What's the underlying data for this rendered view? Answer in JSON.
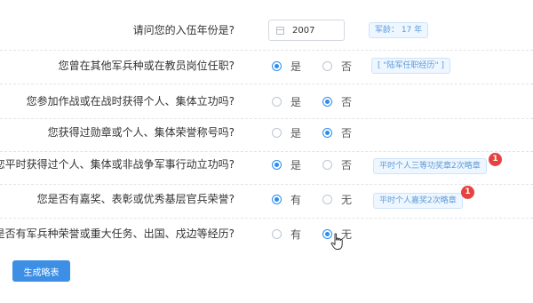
{
  "q1": {
    "label": "请问您的入伍年份是?",
    "year": "2007",
    "age_tag": "军龄：  17 年"
  },
  "q2": {
    "label": "您曾在其他军兵种或在教员岗位任职?",
    "opt1": "是",
    "opt2": "否",
    "selected": "是",
    "tag": "[ \"陆军任职经历\" ]"
  },
  "q3": {
    "label": "您参加作战或在战时获得个人、集体立功吗?",
    "opt1": "是",
    "opt2": "否",
    "selected": "否"
  },
  "q4": {
    "label": "您获得过勋章或个人、集体荣誉称号吗?",
    "opt1": "是",
    "opt2": "否",
    "selected": "否"
  },
  "q5": {
    "label": "您平时获得过个人、集体或非战争军事行动立功吗?",
    "opt1": "是",
    "opt2": "否",
    "selected": "是",
    "tag": "平时个人三等功奖章2次略章",
    "badge": "1"
  },
  "q6": {
    "label": "您是否有嘉奖、表彰或优秀基层官兵荣誉?",
    "opt1": "有",
    "opt2": "无",
    "selected": "有",
    "tag": "平时个人嘉奖2次略章",
    "badge": "1"
  },
  "q7": {
    "label": "您是否有军兵种荣誉或重大任务、出国、戍边等经历?",
    "opt1": "有",
    "opt2": "无",
    "selected": "无"
  },
  "submit_label": "生成略表",
  "colors": {
    "accent": "#2d8cf0",
    "badge": "#e64340",
    "button": "#3d8fe6"
  },
  "icons": {
    "cursor": "hand-pointer-icon",
    "year_input": "calendar-icon"
  }
}
